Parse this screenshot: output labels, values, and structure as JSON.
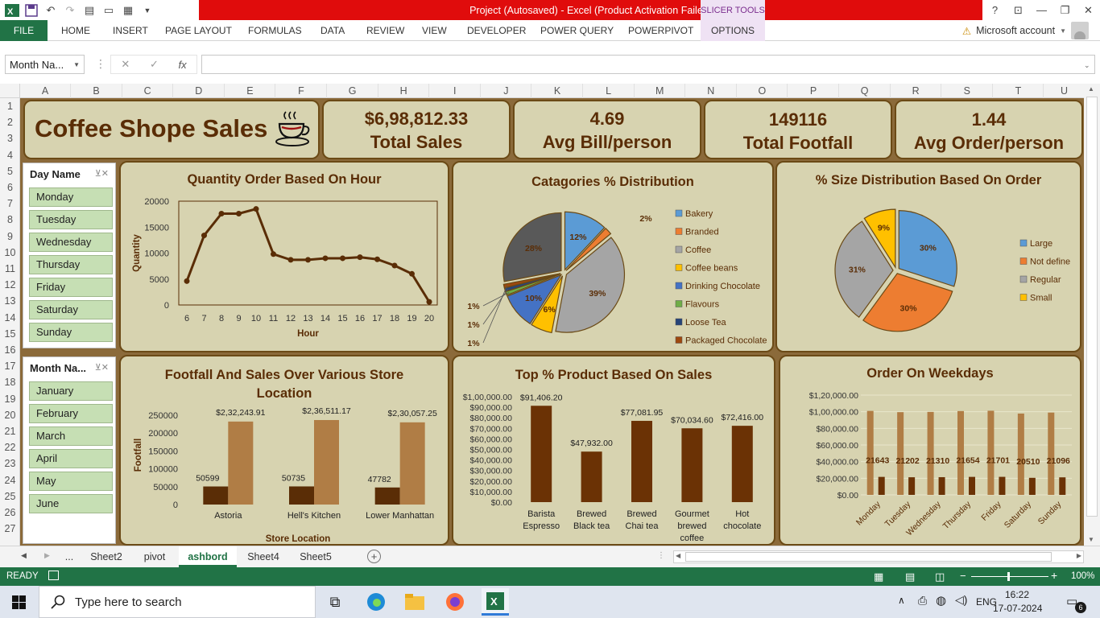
{
  "window": {
    "title": "Project (Autosaved) -  Excel (Product Activation Failed)",
    "slicer_tools": "SLICER TOOLS",
    "help": "?",
    "account": "Microsoft account",
    "warning": "⚠"
  },
  "ribbon": {
    "tabs": [
      "FILE",
      "HOME",
      "INSERT",
      "PAGE LAYOUT",
      "FORMULAS",
      "DATA",
      "REVIEW",
      "VIEW",
      "DEVELOPER",
      "POWER QUERY",
      "POWERPIVOT",
      "OPTIONS"
    ]
  },
  "formula_bar": {
    "name_box": "Month Na...",
    "fx": "fx",
    "value": ""
  },
  "columns": [
    "A",
    "B",
    "C",
    "D",
    "E",
    "F",
    "G",
    "H",
    "I",
    "J",
    "K",
    "L",
    "M",
    "N",
    "O",
    "P",
    "Q",
    "R",
    "S",
    "T",
    "U"
  ],
  "rows": [
    "1",
    "2",
    "3",
    "4",
    "5",
    "6",
    "7",
    "8",
    "9",
    "10",
    "11",
    "12",
    "13",
    "14",
    "15",
    "16",
    "17",
    "18",
    "19",
    "20",
    "21",
    "22",
    "23",
    "24",
    "25",
    "26",
    "27"
  ],
  "dashboard": {
    "title": "Coffee Shope Sales",
    "kpis": [
      {
        "value": "$6,98,812.33",
        "label": "Total Sales"
      },
      {
        "value": "4.69",
        "label": "Avg Bill/person"
      },
      {
        "value": "149116",
        "label": "Total Footfall"
      },
      {
        "value": "1.44",
        "label": "Avg Order/person"
      }
    ],
    "day_slicer": {
      "title": "Day Name",
      "items": [
        "Monday",
        "Tuesday",
        "Wednesday",
        "Thursday",
        "Friday",
        "Saturday",
        "Sunday"
      ]
    },
    "month_slicer": {
      "title": "Month Na...",
      "items": [
        "January",
        "February",
        "March",
        "April",
        "May",
        "June"
      ]
    }
  },
  "chart_data": [
    {
      "type": "line",
      "title": "Quantity Order Based On Hour",
      "xlabel": "Hour",
      "ylabel": "Quantity",
      "x": [
        6,
        7,
        8,
        9,
        10,
        11,
        12,
        13,
        14,
        15,
        16,
        17,
        18,
        19,
        20
      ],
      "values": [
        4600,
        13400,
        17600,
        17600,
        18500,
        9800,
        8700,
        8700,
        9000,
        9000,
        9200,
        8800,
        7600,
        6000,
        600
      ],
      "ylim": [
        0,
        20000
      ],
      "yticks": [
        "0",
        "5000",
        "10000",
        "15000",
        "20000"
      ],
      "color": "#5a2d06"
    },
    {
      "type": "pie",
      "title": "Catagories % Distribution",
      "categories": [
        "Bakery",
        "Branded",
        "Coffee",
        "Coffee beans",
        "Drinking Chocolate",
        "Flavours",
        "Loose Tea",
        "Packaged Chocolate"
      ],
      "values": [
        12,
        2,
        39,
        6,
        10,
        1,
        1,
        1
      ],
      "labels": [
        "12%",
        "2%",
        "39%",
        "6%",
        "10%",
        "1%",
        "1%",
        "1%"
      ],
      "extra_slice": {
        "value": 28,
        "label": "28%",
        "color": "#595959"
      },
      "colors": [
        "#5b9bd5",
        "#ed7d31",
        "#a5a5a5",
        "#ffc000",
        "#4472c4",
        "#70ad47",
        "#264478",
        "#9e480e"
      ],
      "legend": "right"
    },
    {
      "type": "pie",
      "title": "% Size Distribution Based On Order",
      "categories": [
        "Large",
        "Not define",
        "Regular",
        "Small"
      ],
      "values": [
        30,
        30,
        31,
        9
      ],
      "labels": [
        "30%",
        "30%",
        "31%",
        "9%"
      ],
      "colors": [
        "#5b9bd5",
        "#ed7d31",
        "#a5a5a5",
        "#ffc000"
      ],
      "legend": "right"
    },
    {
      "type": "bar",
      "title": "Footfall And Sales Over Various Store Location",
      "xlabel": "Store Location",
      "ylabel": "Footfall",
      "categories": [
        "Astoria",
        "Hell's Kitchen",
        "Lower Manhattan"
      ],
      "series": [
        {
          "values": [
            50599,
            50735,
            47782
          ],
          "labels": [
            "50599",
            "50735",
            "47782"
          ],
          "color": "#5a2d06"
        },
        {
          "values": [
            232243.91,
            236511.17,
            230057.25
          ],
          "labels": [
            "$2,32,243.91",
            "$2,36,511.17",
            "$2,30,057.25"
          ],
          "color": "#b07d45"
        }
      ],
      "ylim": [
        0,
        250000
      ],
      "yticks": [
        "0",
        "50000",
        "100000",
        "150000",
        "200000",
        "250000"
      ]
    },
    {
      "type": "bar",
      "title": "Top % Product Based On Sales",
      "categories": [
        "Barista Espresso",
        "Brewed Black tea",
        "Brewed Chai tea",
        "Gourmet brewed coffee",
        "Hot chocolate"
      ],
      "category_lines": [
        [
          "Barista",
          "Espresso"
        ],
        [
          "Brewed",
          "Black tea"
        ],
        [
          "Brewed",
          "Chai tea"
        ],
        [
          "Gourmet",
          "brewed",
          "coffee"
        ],
        [
          "Hot",
          "chocolate"
        ]
      ],
      "values": [
        91406.2,
        47932.0,
        77081.95,
        70034.6,
        72416.0
      ],
      "labels": [
        "$91,406.20",
        "$47,932.00",
        "$77,081.95",
        "$70,034.60",
        "$72,416.00"
      ],
      "ylim": [
        0,
        100000
      ],
      "yticks": [
        "$0.00",
        "$10,000.00",
        "$20,000.00",
        "$30,000.00",
        "$40,000.00",
        "$50,000.00",
        "$60,000.00",
        "$70,000.00",
        "$80,000.00",
        "$90,000.00",
        "$1,00,000.00"
      ],
      "color": "#6b3205"
    },
    {
      "type": "bar",
      "title": "Order On Weekdays",
      "categories": [
        "Monday",
        "Tuesday",
        "Wednesday",
        "Thursday",
        "Friday",
        "Saturday",
        "Sunday"
      ],
      "series": [
        {
          "values": [
            101000,
            99500,
            99800,
            100800,
            101200,
            97800,
            99000
          ],
          "color": "#b07d45"
        },
        {
          "values": [
            21643,
            21202,
            21310,
            21654,
            21701,
            20510,
            21096
          ],
          "labels": [
            "21643",
            "21202",
            "21310",
            "21654",
            "21701",
            "20510",
            "21096"
          ],
          "color": "#6b3205"
        }
      ],
      "ylim": [
        0,
        120000
      ],
      "yticks": [
        "$0.00",
        "$20,000.00",
        "$40,000.00",
        "$60,000.00",
        "$80,000.00",
        "$1,00,000.00",
        "$1,20,000.00"
      ]
    }
  ],
  "sheet_tabs": {
    "ellipsis": "...",
    "tabs": [
      "Sheet2",
      "pivot",
      "ashbord",
      "Sheet4",
      "Sheet5"
    ],
    "active": "ashbord",
    "add": "+"
  },
  "status": {
    "ready": "READY",
    "zoom": "100%"
  },
  "taskbar": {
    "search_placeholder": "Type here to search",
    "language": "ENG",
    "time": "16:22",
    "date": "17-07-2024",
    "notifications": "6"
  }
}
